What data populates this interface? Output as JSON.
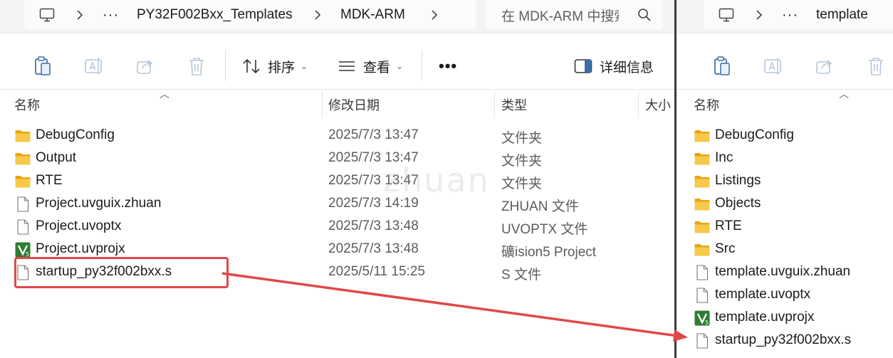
{
  "left": {
    "breadcrumb": [
      "PY32F002Bxx_Templates",
      "MDK-ARM"
    ],
    "more_crumbs": "···",
    "search_placeholder": "在 MDK-ARM 中搜索",
    "toolbar": {
      "sort_label": "排序",
      "view_label": "查看",
      "more_label": "•••",
      "details_label": "详细信息"
    },
    "columns": {
      "name": "名称",
      "date": "修改日期",
      "type": "类型",
      "size": "大小"
    },
    "files": [
      {
        "name": "DebugConfig",
        "date": "2025/7/3 13:47",
        "type": "文件夹",
        "icon": "folder-icon"
      },
      {
        "name": "Output",
        "date": "2025/7/3 13:47",
        "type": "文件夹",
        "icon": "folder-icon"
      },
      {
        "name": "RTE",
        "date": "2025/7/3 13:47",
        "type": "文件夹",
        "icon": "folder-icon"
      },
      {
        "name": "Project.uvguix.zhuan",
        "date": "2025/7/3 14:19",
        "type": "ZHUAN 文件",
        "icon": "file-icon"
      },
      {
        "name": "Project.uvoptx",
        "date": "2025/7/3 13:48",
        "type": "UVOPTX 文件",
        "icon": "file-icon"
      },
      {
        "name": "Project.uvprojx",
        "date": "2025/7/3 13:48",
        "type": "礦ision5 Project",
        "icon": "keil-project-icon"
      },
      {
        "name": "startup_py32f002bxx.s",
        "date": "2025/5/11 15:25",
        "type": "S 文件",
        "icon": "file-icon"
      }
    ]
  },
  "right": {
    "breadcrumb": [
      "template"
    ],
    "more_crumbs": "···",
    "columns": {
      "name": "名称"
    },
    "files": [
      {
        "name": "DebugConfig",
        "icon": "folder-icon"
      },
      {
        "name": "Inc",
        "icon": "folder-icon"
      },
      {
        "name": "Listings",
        "icon": "folder-icon"
      },
      {
        "name": "Objects",
        "icon": "folder-icon"
      },
      {
        "name": "RTE",
        "icon": "folder-icon"
      },
      {
        "name": "Src",
        "icon": "folder-icon"
      },
      {
        "name": "template.uvguix.zhuan",
        "icon": "file-icon"
      },
      {
        "name": "template.uvoptx",
        "icon": "file-icon"
      },
      {
        "name": "template.uvprojx",
        "icon": "keil-project-icon"
      },
      {
        "name": "startup_py32f002bxx.s",
        "icon": "file-icon"
      }
    ]
  },
  "watermark": "zhuan",
  "colors": {
    "annotation_red": "#e04848",
    "folder_yellow": "#f7c94b",
    "keil_green": "#2e7d32"
  }
}
